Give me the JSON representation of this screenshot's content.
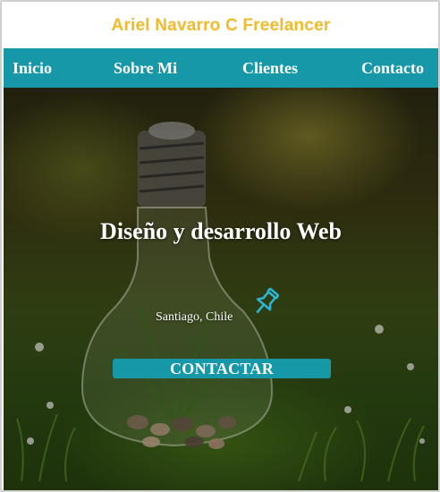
{
  "brand": {
    "title": "Ariel Navarro C Freelancer"
  },
  "nav": {
    "items": [
      {
        "label": "Inicio"
      },
      {
        "label": "Sobre Mi"
      },
      {
        "label": "Clientes"
      },
      {
        "label": "Contacto"
      }
    ]
  },
  "hero": {
    "headline": "Diseño y desarrollo Web",
    "location": "Santiago, Chile",
    "location_icon": "pushpin-icon",
    "cta_label": "CONTACTAR",
    "background_image": "lightbulb-terrarium-on-grass"
  },
  "colors": {
    "brand_title": "#f2b92a",
    "nav_bg": "#1698a8",
    "cta_bg": "#1698a8",
    "pin": "#29b6d0"
  }
}
